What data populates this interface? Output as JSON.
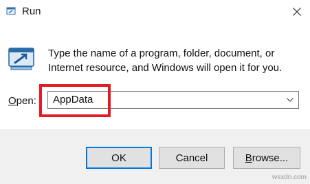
{
  "window": {
    "title": "Run",
    "icons": {
      "app": "run-app-icon",
      "close": "close-icon",
      "dialog": "run-dialog-icon",
      "dropdown": "chevron-down-icon"
    }
  },
  "content": {
    "description": "Type the name of a program, folder, document, or Internet resource, and Windows will open it for you.",
    "open_label_accel": "O",
    "open_label_rest": "pen:",
    "input_value": "AppData"
  },
  "buttons": {
    "ok": "OK",
    "cancel": "Cancel",
    "browse_accel": "B",
    "browse_rest": "rowse..."
  },
  "watermark": "wsxdn.com",
  "colors": {
    "highlight": "#e31b23",
    "default_button_border": "#0078d7",
    "footer_bg": "#f0f0f0"
  }
}
